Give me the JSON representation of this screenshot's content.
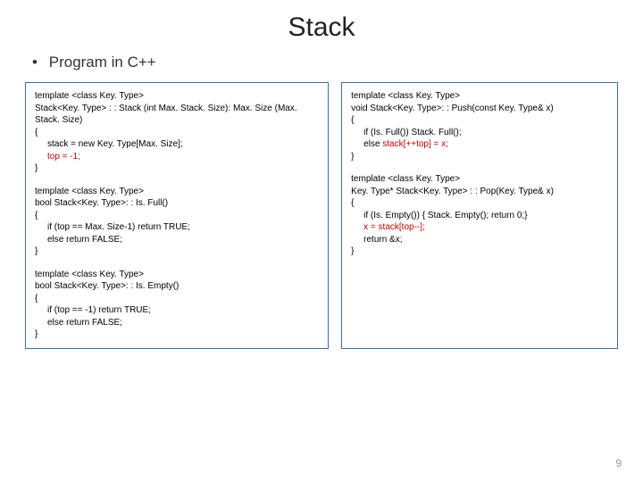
{
  "title": "Stack",
  "bullet": "Program in C++",
  "pagenum": "9",
  "code": {
    "ctor": {
      "l1": "template <class Key. Type>",
      "l2": "Stack<Key. Type> : : Stack (int Max. Stack. Size): Max. Size (Max. Stack. Size)",
      "l3": "{",
      "l4": "stack = new Key. Type[Max. Size];",
      "l5_red": "top = -1;",
      "l6": "}"
    },
    "isfull": {
      "l1": "template <class Key. Type>",
      "l2": "bool Stack<Key. Type>: : Is. Full()",
      "l3": "{",
      "l4": "if (top == Max. Size-1) return TRUE;",
      "l5": "else return FALSE;",
      "l6": "}"
    },
    "isempty": {
      "l1": "template <class Key. Type>",
      "l2": "bool Stack<Key. Type>: : Is. Empty()",
      "l3": "{",
      "l4": "if (top == -1) return TRUE;",
      "l5": "else return FALSE;",
      "l6": "}"
    },
    "push": {
      "l1": "template <class Key. Type>",
      "l2": "void Stack<Key. Type>: : Push(const Key. Type& x)",
      "l3": "{",
      "l4": "if (Is. Full()) Stack. Full();",
      "l5a": "else ",
      "l5b_red": "stack[++top] = x;",
      "l6": "}"
    },
    "pop": {
      "l1": "template <class Key. Type>",
      "l2": "Key. Type* Stack<Key. Type> : : Pop(Key. Type& x)",
      "l3": "{",
      "l4": "if (Is. Empty()) { Stack. Empty(); return 0;}",
      "l5_red": "x = stack[top--];",
      "l6": "return &x;",
      "l7": "}"
    }
  }
}
